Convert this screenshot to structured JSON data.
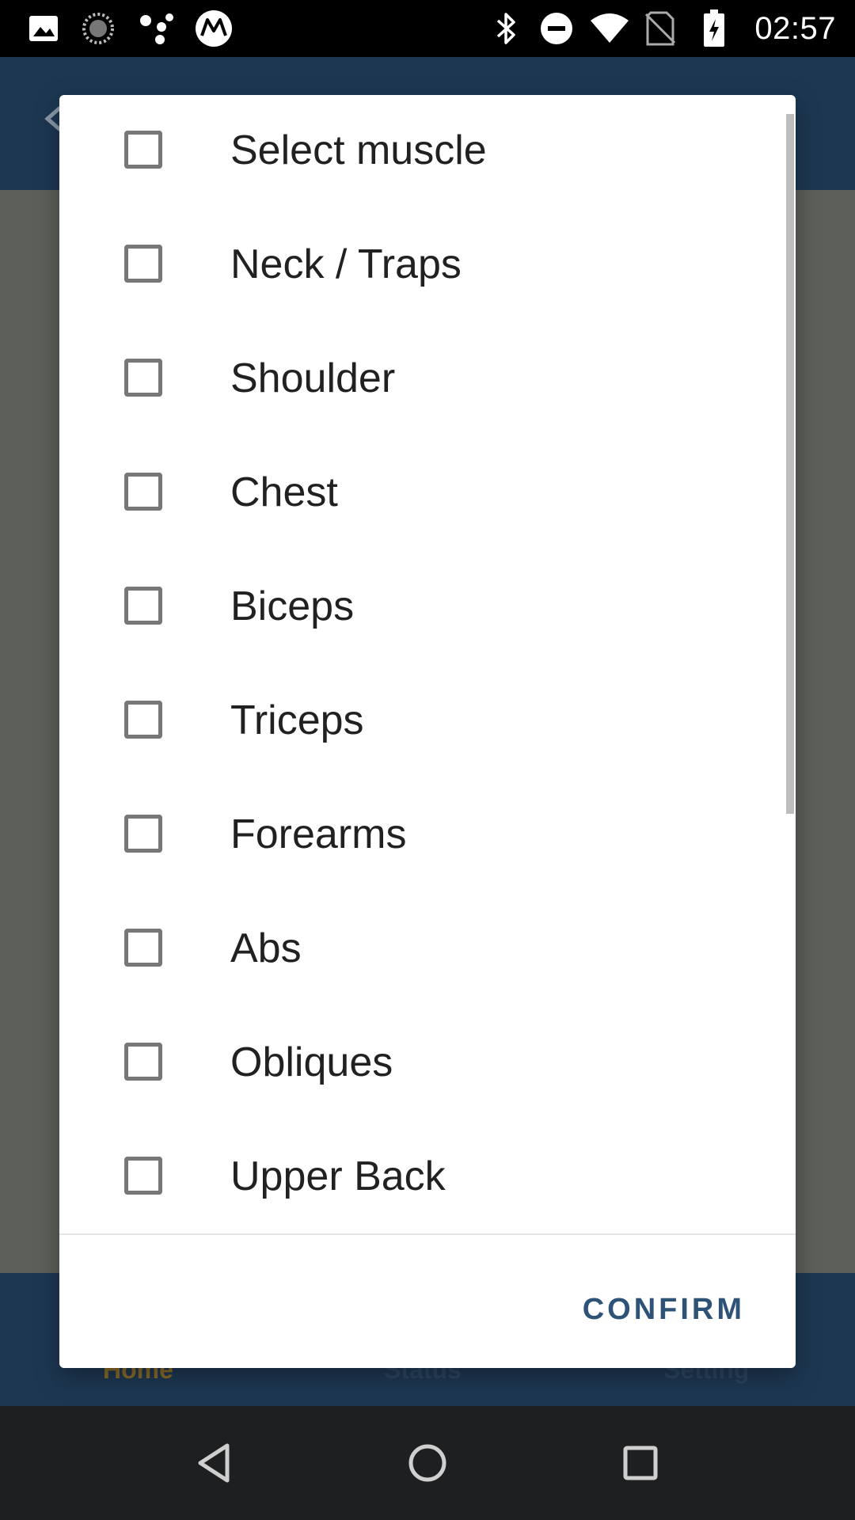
{
  "status_bar": {
    "time": "02:57",
    "left_icons": [
      "gallery-icon",
      "sync-icon",
      "assistant-dots-icon",
      "motorola-icon"
    ],
    "right_icons": [
      "bluetooth-icon",
      "do-not-disturb-icon",
      "wifi-icon",
      "no-sim-icon",
      "battery-charging-icon"
    ]
  },
  "app": {
    "bottom_nav": {
      "home": "Home",
      "status": "Status",
      "setting": "Setting"
    }
  },
  "dialog": {
    "options": [
      {
        "label": "Select muscle",
        "checked": false
      },
      {
        "label": "Neck / Traps",
        "checked": false
      },
      {
        "label": "Shoulder",
        "checked": false
      },
      {
        "label": "Chest",
        "checked": false
      },
      {
        "label": "Biceps",
        "checked": false
      },
      {
        "label": "Triceps",
        "checked": false
      },
      {
        "label": "Forearms",
        "checked": false
      },
      {
        "label": "Abs",
        "checked": false
      },
      {
        "label": "Obliques",
        "checked": false
      },
      {
        "label": "Upper Back",
        "checked": false
      }
    ],
    "confirm_label": "CONFIRM"
  },
  "colors": {
    "accent": "#2e5377",
    "app_bar": "#1d3752",
    "scrim": "#5a5c57"
  }
}
